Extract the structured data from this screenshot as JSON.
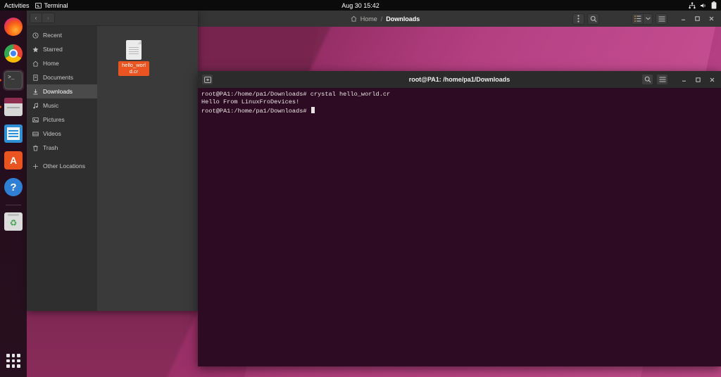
{
  "topbar": {
    "activities": "Activities",
    "app_name": "Terminal",
    "app_icon": "terminal-icon",
    "clock": "Aug 30  15:42",
    "tray": [
      {
        "name": "network-icon"
      },
      {
        "name": "volume-icon"
      },
      {
        "name": "battery-icon"
      }
    ]
  },
  "dock": {
    "items": [
      {
        "name": "firefox",
        "label": "Firefox",
        "state": "idle"
      },
      {
        "name": "chrome",
        "label": "Google Chrome",
        "state": "idle"
      },
      {
        "name": "terminal",
        "label": "Terminal",
        "state": "active"
      },
      {
        "name": "files",
        "label": "Files",
        "state": "running"
      },
      {
        "name": "writer",
        "label": "LibreOffice Writer",
        "state": "idle"
      },
      {
        "name": "software",
        "label": "Ubuntu Software",
        "state": "idle"
      },
      {
        "name": "help",
        "label": "Help",
        "state": "idle"
      },
      {
        "name": "trash",
        "label": "Trash",
        "state": "idle"
      }
    ],
    "show_apps_label": "Show Applications"
  },
  "files_window": {
    "nav": {
      "back": "‹",
      "forward": "›"
    },
    "breadcrumb": {
      "home": "Home",
      "separator": "/",
      "current": "Downloads"
    },
    "toolbar": {
      "menu_label": "⋮",
      "search_label": "search-icon",
      "view_list_label": "list-view-icon",
      "view_chevron_label": "⌄",
      "hamburger_label": "☰",
      "minimize": "–",
      "maximize": "□",
      "close": "×"
    },
    "sidebar": [
      {
        "label": "Recent",
        "icon": "clock-icon",
        "selected": false
      },
      {
        "label": "Starred",
        "icon": "star-icon",
        "selected": false
      },
      {
        "label": "Home",
        "icon": "home-icon",
        "selected": false
      },
      {
        "label": "Documents",
        "icon": "document-icon",
        "selected": false
      },
      {
        "label": "Downloads",
        "icon": "download-icon",
        "selected": true
      },
      {
        "label": "Music",
        "icon": "music-note-icon",
        "selected": false
      },
      {
        "label": "Pictures",
        "icon": "image-icon",
        "selected": false
      },
      {
        "label": "Videos",
        "icon": "video-icon",
        "selected": false
      },
      {
        "label": "Trash",
        "icon": "trash-icon",
        "selected": false
      },
      {
        "label": "Other Locations",
        "icon": "plus-icon",
        "selected": false
      }
    ],
    "files": [
      {
        "name": "hello_world.cr",
        "icon": "text-file-icon",
        "selected": true
      }
    ]
  },
  "terminal": {
    "title": "root@PA1: /home/pa1/Downloads",
    "new_tab_label": "new-tab-icon",
    "toolbar": {
      "search": "search-icon",
      "hamburger": "☰",
      "minimize": "–",
      "maximize": "□",
      "close": "×"
    },
    "lines": [
      "root@PA1:/home/pa1/Downloads# crystal hello_world.cr",
      "Hello From LinuxFroDevices!",
      "root@PA1:/home/pa1/Downloads# "
    ]
  },
  "colors": {
    "ubuntu_orange": "#e95420",
    "terminal_bg": "#2d0b22",
    "window_chrome": "#353535",
    "sidebar_bg": "#2f2f2f",
    "wallpaper_magenta": "#a8357a"
  }
}
